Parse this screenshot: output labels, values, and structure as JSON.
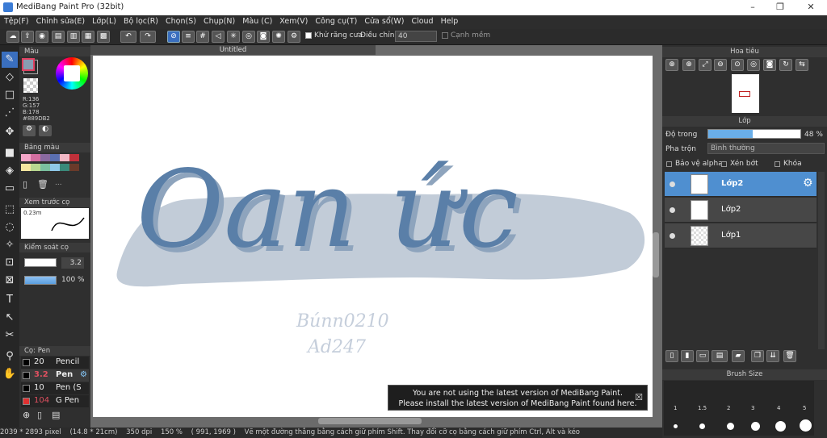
{
  "window": {
    "title": "MediBang Paint Pro (32bit)",
    "controls": [
      "–",
      "❐",
      "✕"
    ]
  },
  "menu": [
    "Tệp(F)",
    "Chỉnh sửa(E)",
    "Lớp(L)",
    "Bộ lọc(R)",
    "Chọn(S)",
    "Chụp(N)",
    "Màu (C)",
    "Xem(V)",
    "Công cụ(T)",
    "Cửa sổ(W)",
    "Cloud",
    "Help"
  ],
  "toolbar": {
    "antialias_label": "Khử răng cưa",
    "adjust_label": "Điều chỉnh",
    "adjust_value": "40",
    "smooth_label": "Cạnh mềm"
  },
  "panels": {
    "color": {
      "title": "Màu",
      "r": "R:136",
      "g": "G:157",
      "b": "B:178",
      "hex": "#889DB2",
      "fg": "#e04060",
      "bg": "#ffffff"
    },
    "palette": {
      "title": "Bảng màu",
      "more": "..."
    },
    "brush_preview": {
      "title": "Xem trước cọ",
      "size": "0.23m"
    },
    "brush_control": {
      "title": "Kiểm soát cọ",
      "size_value": "3.2",
      "opacity_value": "100 %"
    },
    "brushes": {
      "title": "Cọ: Pen",
      "items": [
        {
          "size": "20",
          "name": "Pencil",
          "color": "#000000"
        },
        {
          "size": "3.2",
          "name": "Pen",
          "color": "#000000",
          "selected": true
        },
        {
          "size": "10",
          "name": "Pen (S",
          "color": "#000000"
        },
        {
          "size": "104",
          "name": "G Pen",
          "color": "#e03030"
        }
      ]
    }
  },
  "canvas": {
    "tab": "Untitled",
    "text": "Oan ức",
    "sig1": "Búnn0210",
    "sig2": "Ad247",
    "stroke_color": "#5a7fa8",
    "shadow_color": "#8ea4bd",
    "blob_color": "#c2ccd8"
  },
  "right": {
    "navigator_title": "Hoa tiêu",
    "layer_title": "Lớp",
    "opacity_label": "Độ trong",
    "opacity_value": "48 %",
    "opacity_fraction": 0.48,
    "blend_label": "Pha trộn",
    "blend_value": "Bình thường",
    "protect_alpha": "Bảo vệ alpha",
    "clip": "Xén bớt",
    "lock": "Khóa",
    "layers": [
      {
        "name": "Lớp2",
        "selected": true
      },
      {
        "name": "Lớp2",
        "selected": false
      },
      {
        "name": "Lớp1",
        "selected": false
      }
    ],
    "brush_size_title": "Brush Size",
    "brush_sizes": [
      "1",
      "1.5",
      "2",
      "3",
      "4",
      "5"
    ]
  },
  "notice": {
    "line1": "You are not using the latest version of MediBang Paint.",
    "line2": "Please install the latest version of MediBang Paint found here.",
    "close": "☒"
  },
  "status": {
    "pixels": "2039 * 2893 pixel",
    "cm": "(14.8 * 21cm)",
    "dpi": "350 dpi",
    "zoom": "150 %",
    "coords": "( 991, 1969 )",
    "hint": "Vẽ một đường thẳng bằng cách giữ phím Shift. Thay đổi cỡ cọ bằng cách giữ phím Ctrl, Alt và kéo"
  }
}
